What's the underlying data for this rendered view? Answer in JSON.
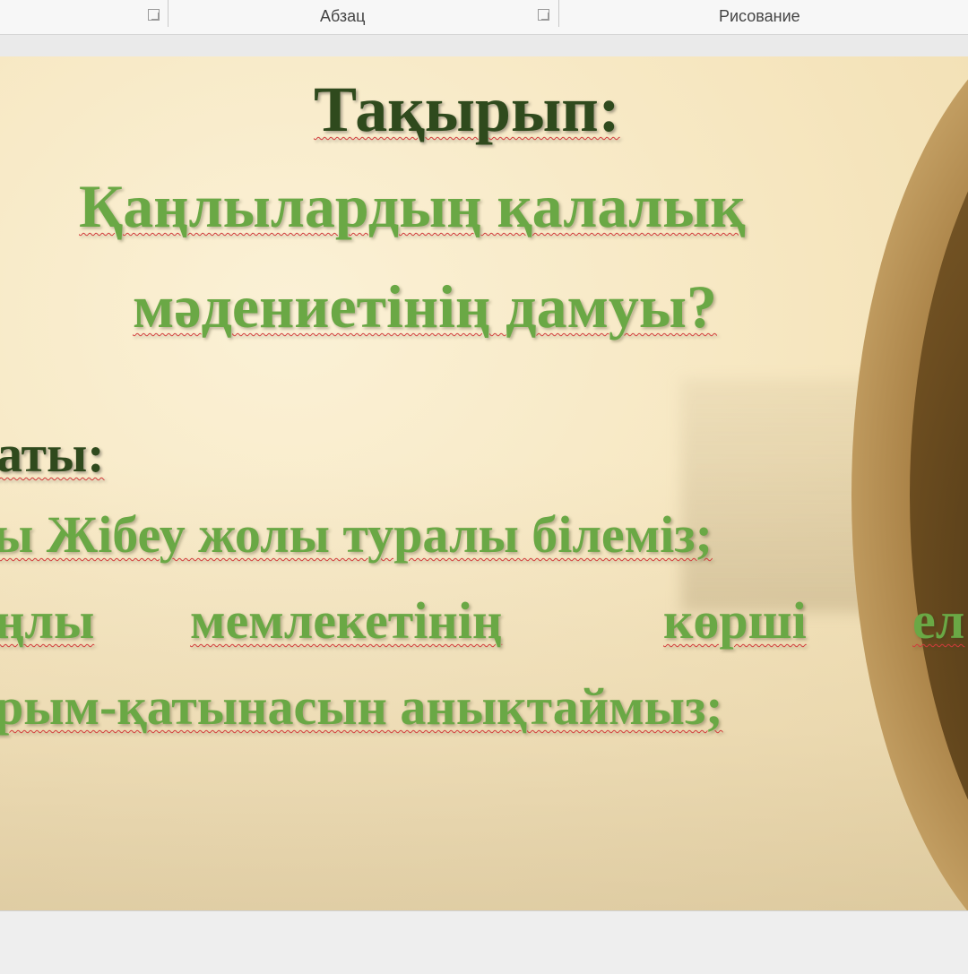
{
  "ribbon": {
    "group1_label": "Абзац",
    "group2_label": "Рисование"
  },
  "slide": {
    "heading": "Тақырып:",
    "title_line1": "Қаңлылардың қалалық",
    "title_line2": "мәдениетінің дамуы?",
    "section_label": "аты:",
    "bullet_line1": "ы Жібеу жолы туралы білеміз;",
    "bullet_line2_w1": "ңлы",
    "bullet_line2_w2": "мемлекетінің",
    "bullet_line2_w3": "көрші",
    "bullet_line2_w4": "ел",
    "bullet_line3": "рым-қатынасын анықтаймыз;"
  },
  "colors": {
    "heading_dark_green": "#2f4a1d",
    "text_light_green": "#6aa845",
    "slide_background": "#f6e6bf",
    "spellcheck_underline": "#d23b3b"
  }
}
